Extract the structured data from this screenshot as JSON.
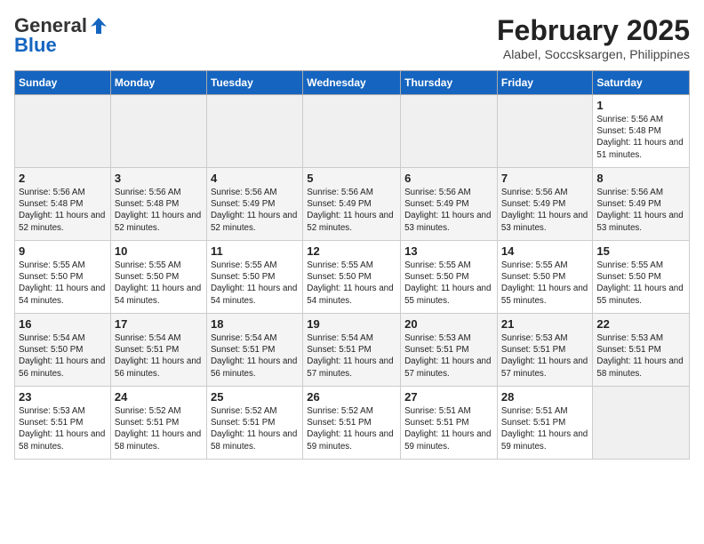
{
  "logo": {
    "general": "General",
    "blue": "Blue"
  },
  "title": "February 2025",
  "subtitle": "Alabel, Soccsksargen, Philippines",
  "days_of_week": [
    "Sunday",
    "Monday",
    "Tuesday",
    "Wednesday",
    "Thursday",
    "Friday",
    "Saturday"
  ],
  "weeks": [
    [
      {
        "day": "",
        "info": ""
      },
      {
        "day": "",
        "info": ""
      },
      {
        "day": "",
        "info": ""
      },
      {
        "day": "",
        "info": ""
      },
      {
        "day": "",
        "info": ""
      },
      {
        "day": "",
        "info": ""
      },
      {
        "day": "1",
        "info": "Sunrise: 5:56 AM\nSunset: 5:48 PM\nDaylight: 11 hours and 51 minutes."
      }
    ],
    [
      {
        "day": "2",
        "info": "Sunrise: 5:56 AM\nSunset: 5:48 PM\nDaylight: 11 hours and 52 minutes."
      },
      {
        "day": "3",
        "info": "Sunrise: 5:56 AM\nSunset: 5:48 PM\nDaylight: 11 hours and 52 minutes."
      },
      {
        "day": "4",
        "info": "Sunrise: 5:56 AM\nSunset: 5:49 PM\nDaylight: 11 hours and 52 minutes."
      },
      {
        "day": "5",
        "info": "Sunrise: 5:56 AM\nSunset: 5:49 PM\nDaylight: 11 hours and 52 minutes."
      },
      {
        "day": "6",
        "info": "Sunrise: 5:56 AM\nSunset: 5:49 PM\nDaylight: 11 hours and 53 minutes."
      },
      {
        "day": "7",
        "info": "Sunrise: 5:56 AM\nSunset: 5:49 PM\nDaylight: 11 hours and 53 minutes."
      },
      {
        "day": "8",
        "info": "Sunrise: 5:56 AM\nSunset: 5:49 PM\nDaylight: 11 hours and 53 minutes."
      }
    ],
    [
      {
        "day": "9",
        "info": "Sunrise: 5:55 AM\nSunset: 5:50 PM\nDaylight: 11 hours and 54 minutes."
      },
      {
        "day": "10",
        "info": "Sunrise: 5:55 AM\nSunset: 5:50 PM\nDaylight: 11 hours and 54 minutes."
      },
      {
        "day": "11",
        "info": "Sunrise: 5:55 AM\nSunset: 5:50 PM\nDaylight: 11 hours and 54 minutes."
      },
      {
        "day": "12",
        "info": "Sunrise: 5:55 AM\nSunset: 5:50 PM\nDaylight: 11 hours and 54 minutes."
      },
      {
        "day": "13",
        "info": "Sunrise: 5:55 AM\nSunset: 5:50 PM\nDaylight: 11 hours and 55 minutes."
      },
      {
        "day": "14",
        "info": "Sunrise: 5:55 AM\nSunset: 5:50 PM\nDaylight: 11 hours and 55 minutes."
      },
      {
        "day": "15",
        "info": "Sunrise: 5:55 AM\nSunset: 5:50 PM\nDaylight: 11 hours and 55 minutes."
      }
    ],
    [
      {
        "day": "16",
        "info": "Sunrise: 5:54 AM\nSunset: 5:50 PM\nDaylight: 11 hours and 56 minutes."
      },
      {
        "day": "17",
        "info": "Sunrise: 5:54 AM\nSunset: 5:51 PM\nDaylight: 11 hours and 56 minutes."
      },
      {
        "day": "18",
        "info": "Sunrise: 5:54 AM\nSunset: 5:51 PM\nDaylight: 11 hours and 56 minutes."
      },
      {
        "day": "19",
        "info": "Sunrise: 5:54 AM\nSunset: 5:51 PM\nDaylight: 11 hours and 57 minutes."
      },
      {
        "day": "20",
        "info": "Sunrise: 5:53 AM\nSunset: 5:51 PM\nDaylight: 11 hours and 57 minutes."
      },
      {
        "day": "21",
        "info": "Sunrise: 5:53 AM\nSunset: 5:51 PM\nDaylight: 11 hours and 57 minutes."
      },
      {
        "day": "22",
        "info": "Sunrise: 5:53 AM\nSunset: 5:51 PM\nDaylight: 11 hours and 58 minutes."
      }
    ],
    [
      {
        "day": "23",
        "info": "Sunrise: 5:53 AM\nSunset: 5:51 PM\nDaylight: 11 hours and 58 minutes."
      },
      {
        "day": "24",
        "info": "Sunrise: 5:52 AM\nSunset: 5:51 PM\nDaylight: 11 hours and 58 minutes."
      },
      {
        "day": "25",
        "info": "Sunrise: 5:52 AM\nSunset: 5:51 PM\nDaylight: 11 hours and 58 minutes."
      },
      {
        "day": "26",
        "info": "Sunrise: 5:52 AM\nSunset: 5:51 PM\nDaylight: 11 hours and 59 minutes."
      },
      {
        "day": "27",
        "info": "Sunrise: 5:51 AM\nSunset: 5:51 PM\nDaylight: 11 hours and 59 minutes."
      },
      {
        "day": "28",
        "info": "Sunrise: 5:51 AM\nSunset: 5:51 PM\nDaylight: 11 hours and 59 minutes."
      },
      {
        "day": "",
        "info": ""
      }
    ]
  ]
}
